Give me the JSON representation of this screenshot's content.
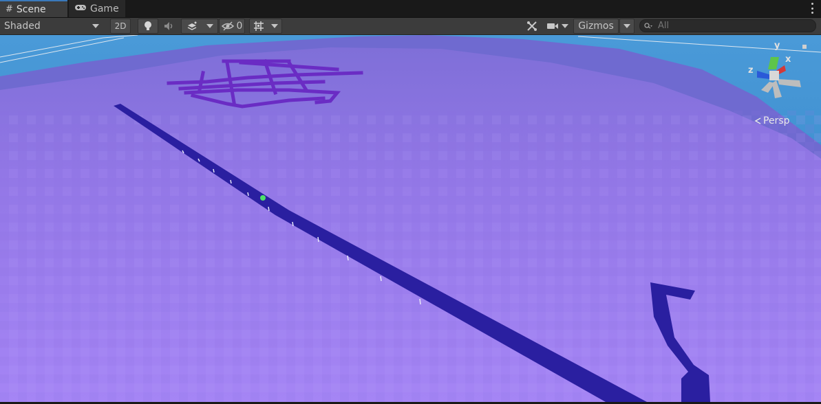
{
  "tabs": [
    {
      "label": "Scene",
      "icon": "grid-hash-icon",
      "active": true
    },
    {
      "label": "Game",
      "icon": "gamepad-icon",
      "active": false
    }
  ],
  "toolbar": {
    "draw_mode": "Shaded",
    "toggle_2d": "2D",
    "hidden_count": "0",
    "gizmos_label": "Gizmos"
  },
  "search": {
    "placeholder": "All"
  },
  "scene_gizmo": {
    "axis_y": "y",
    "axis_x": "x",
    "axis_z": "z",
    "projection": "Persp"
  },
  "colors": {
    "terrain": "#9b7df0",
    "road": "#2a1fa0",
    "sky": "#3a8fd0",
    "active_tab_accent": "#3a79bb"
  }
}
